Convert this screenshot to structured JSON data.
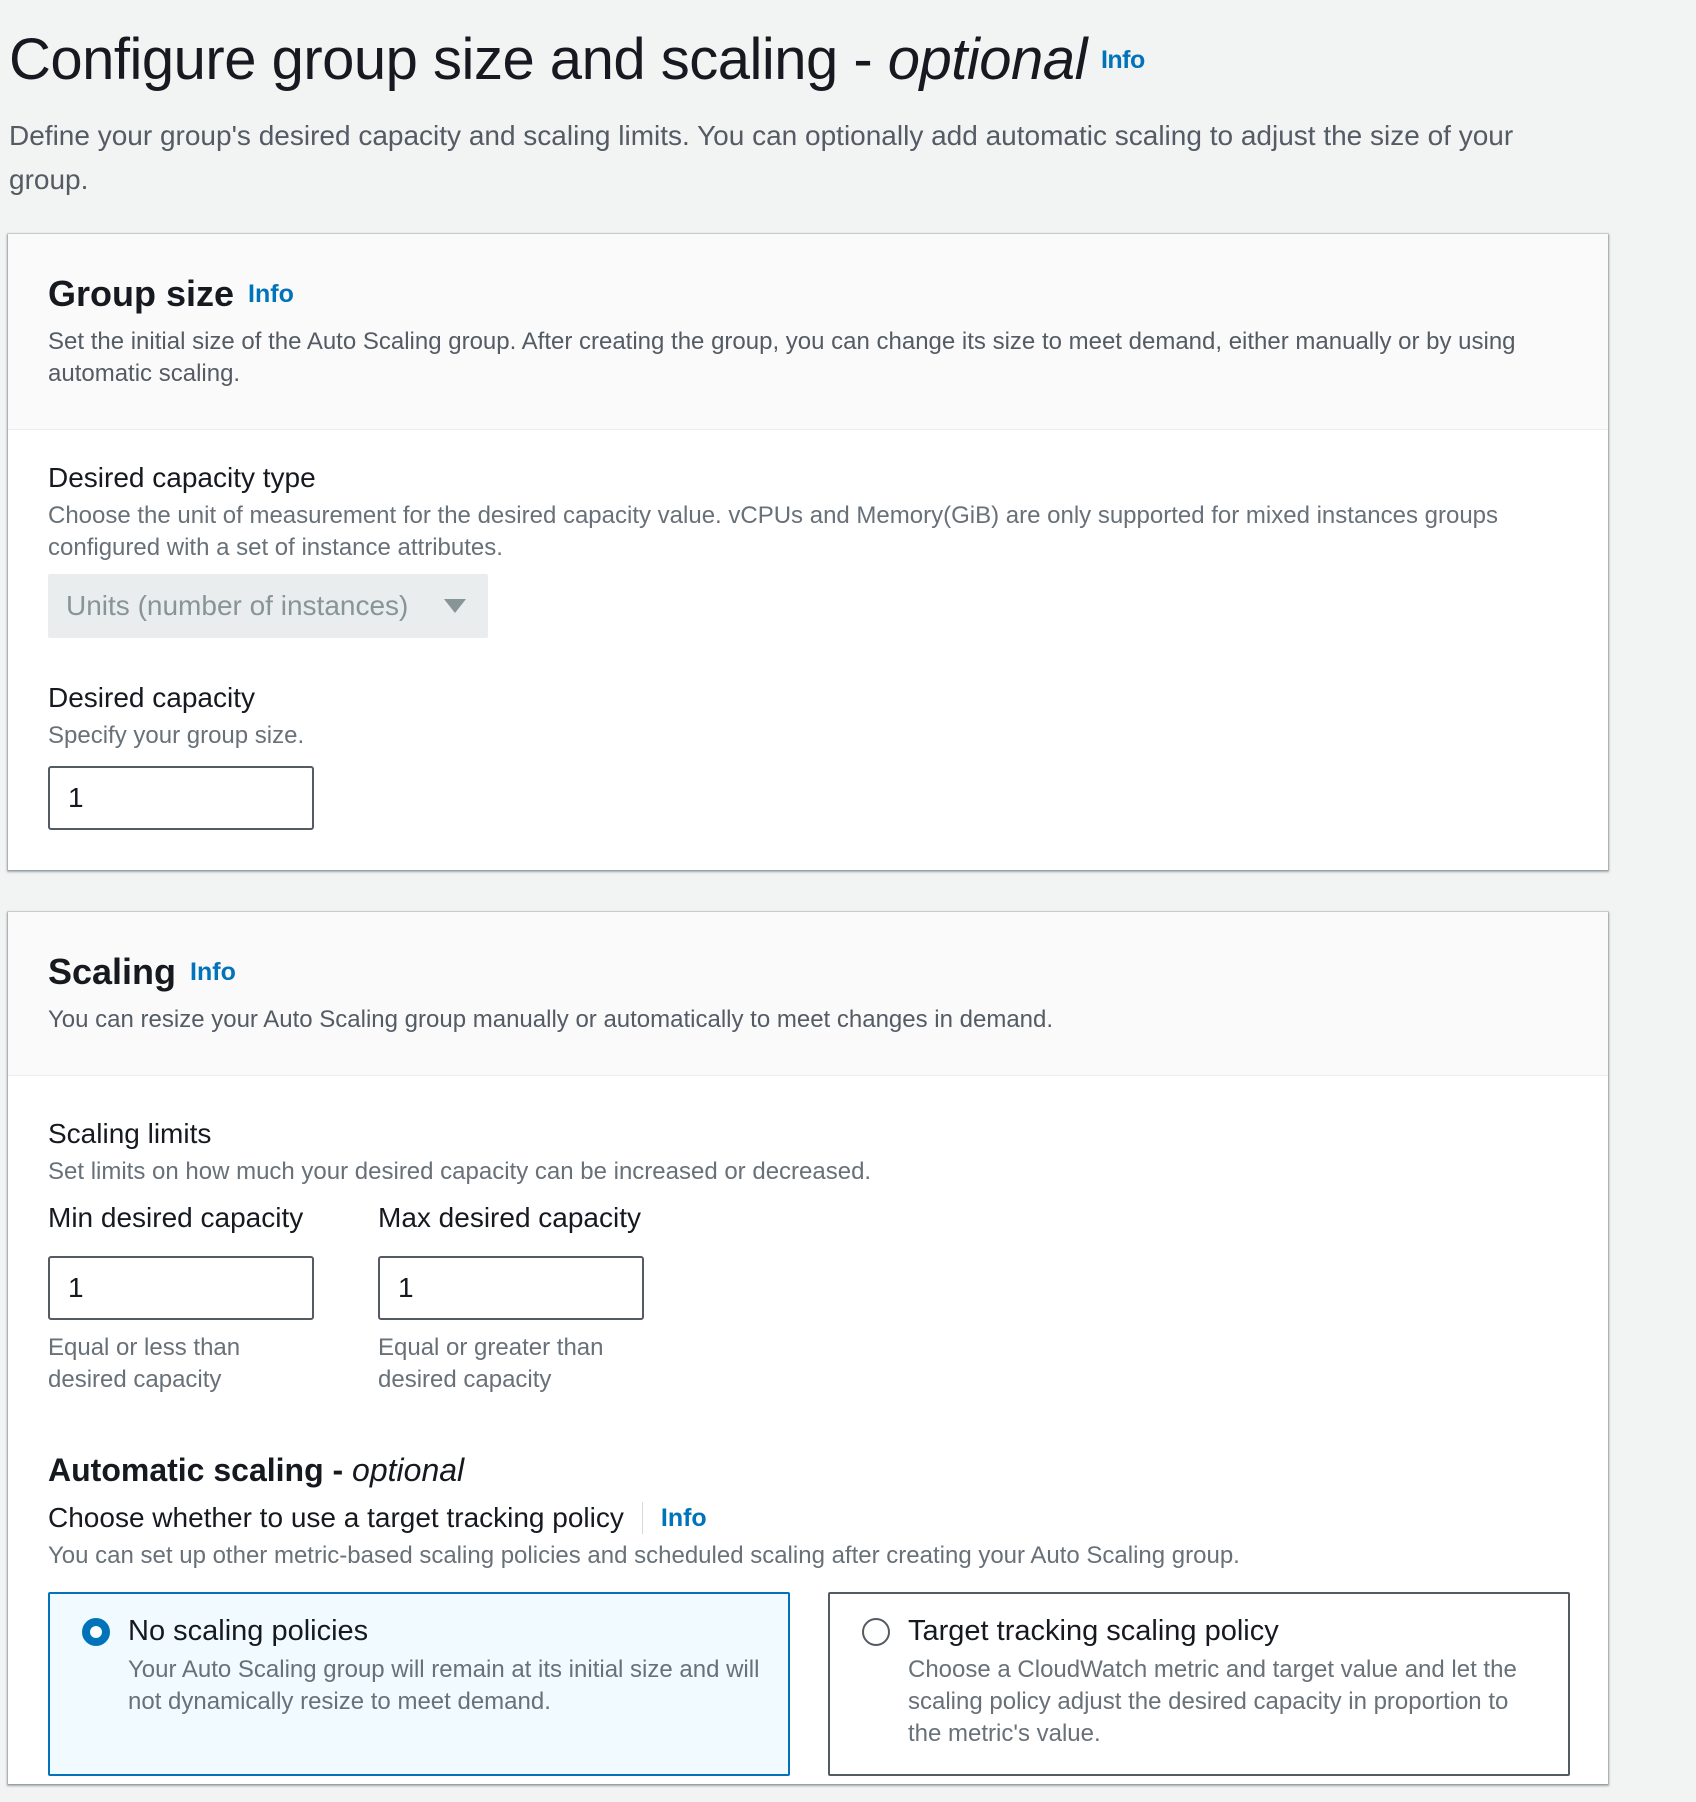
{
  "page": {
    "title": "Configure group size and scaling - ",
    "title_optional": "optional",
    "info": "Info",
    "description": "Define your group's desired capacity and scaling limits. You can optionally add automatic scaling to adjust the size of your group."
  },
  "group_size": {
    "title": "Group size",
    "info": "Info",
    "description": "Set the initial size of the Auto Scaling group. After creating the group, you can change its size to meet demand, either manually or by using automatic scaling.",
    "capacity_type": {
      "label": "Desired capacity type",
      "description": "Choose the unit of measurement for the desired capacity value. vCPUs and Memory(GiB) are only supported for mixed instances groups configured with a set of instance attributes.",
      "selected": "Units (number of instances)"
    },
    "desired_capacity": {
      "label": "Desired capacity",
      "description": "Specify your group size.",
      "value": "1"
    }
  },
  "scaling": {
    "title": "Scaling",
    "info": "Info",
    "description": "You can resize your Auto Scaling group manually or automatically to meet changes in demand.",
    "limits": {
      "label": "Scaling limits",
      "description": "Set limits on how much your desired capacity can be increased or decreased.",
      "min": {
        "label": "Min desired capacity",
        "value": "1",
        "hint_line1": "Equal or less than",
        "hint_line2": "desired capacity"
      },
      "max": {
        "label": "Max desired capacity",
        "value": "1",
        "hint_line1": "Equal or greater than",
        "hint_line2": "desired capacity"
      }
    },
    "automatic": {
      "title": "Automatic scaling - ",
      "title_optional": "optional",
      "question": "Choose whether to use a target tracking policy",
      "info": "Info",
      "description": "You can set up other metric-based scaling policies and scheduled scaling after creating your Auto Scaling group.",
      "options": [
        {
          "label": "No scaling policies",
          "description": "Your Auto Scaling group will remain at its initial size and will not dynamically resize to meet demand.",
          "selected": true
        },
        {
          "label": "Target tracking scaling policy",
          "description": "Choose a CloudWatch metric and target value and let the scaling policy adjust the desired capacity in proportion to the metric's value.",
          "selected": false
        }
      ]
    }
  },
  "colors": {
    "accent": "#0073bb",
    "background": "#f2f3f3",
    "selected_tile_bg": "#f1faff"
  }
}
